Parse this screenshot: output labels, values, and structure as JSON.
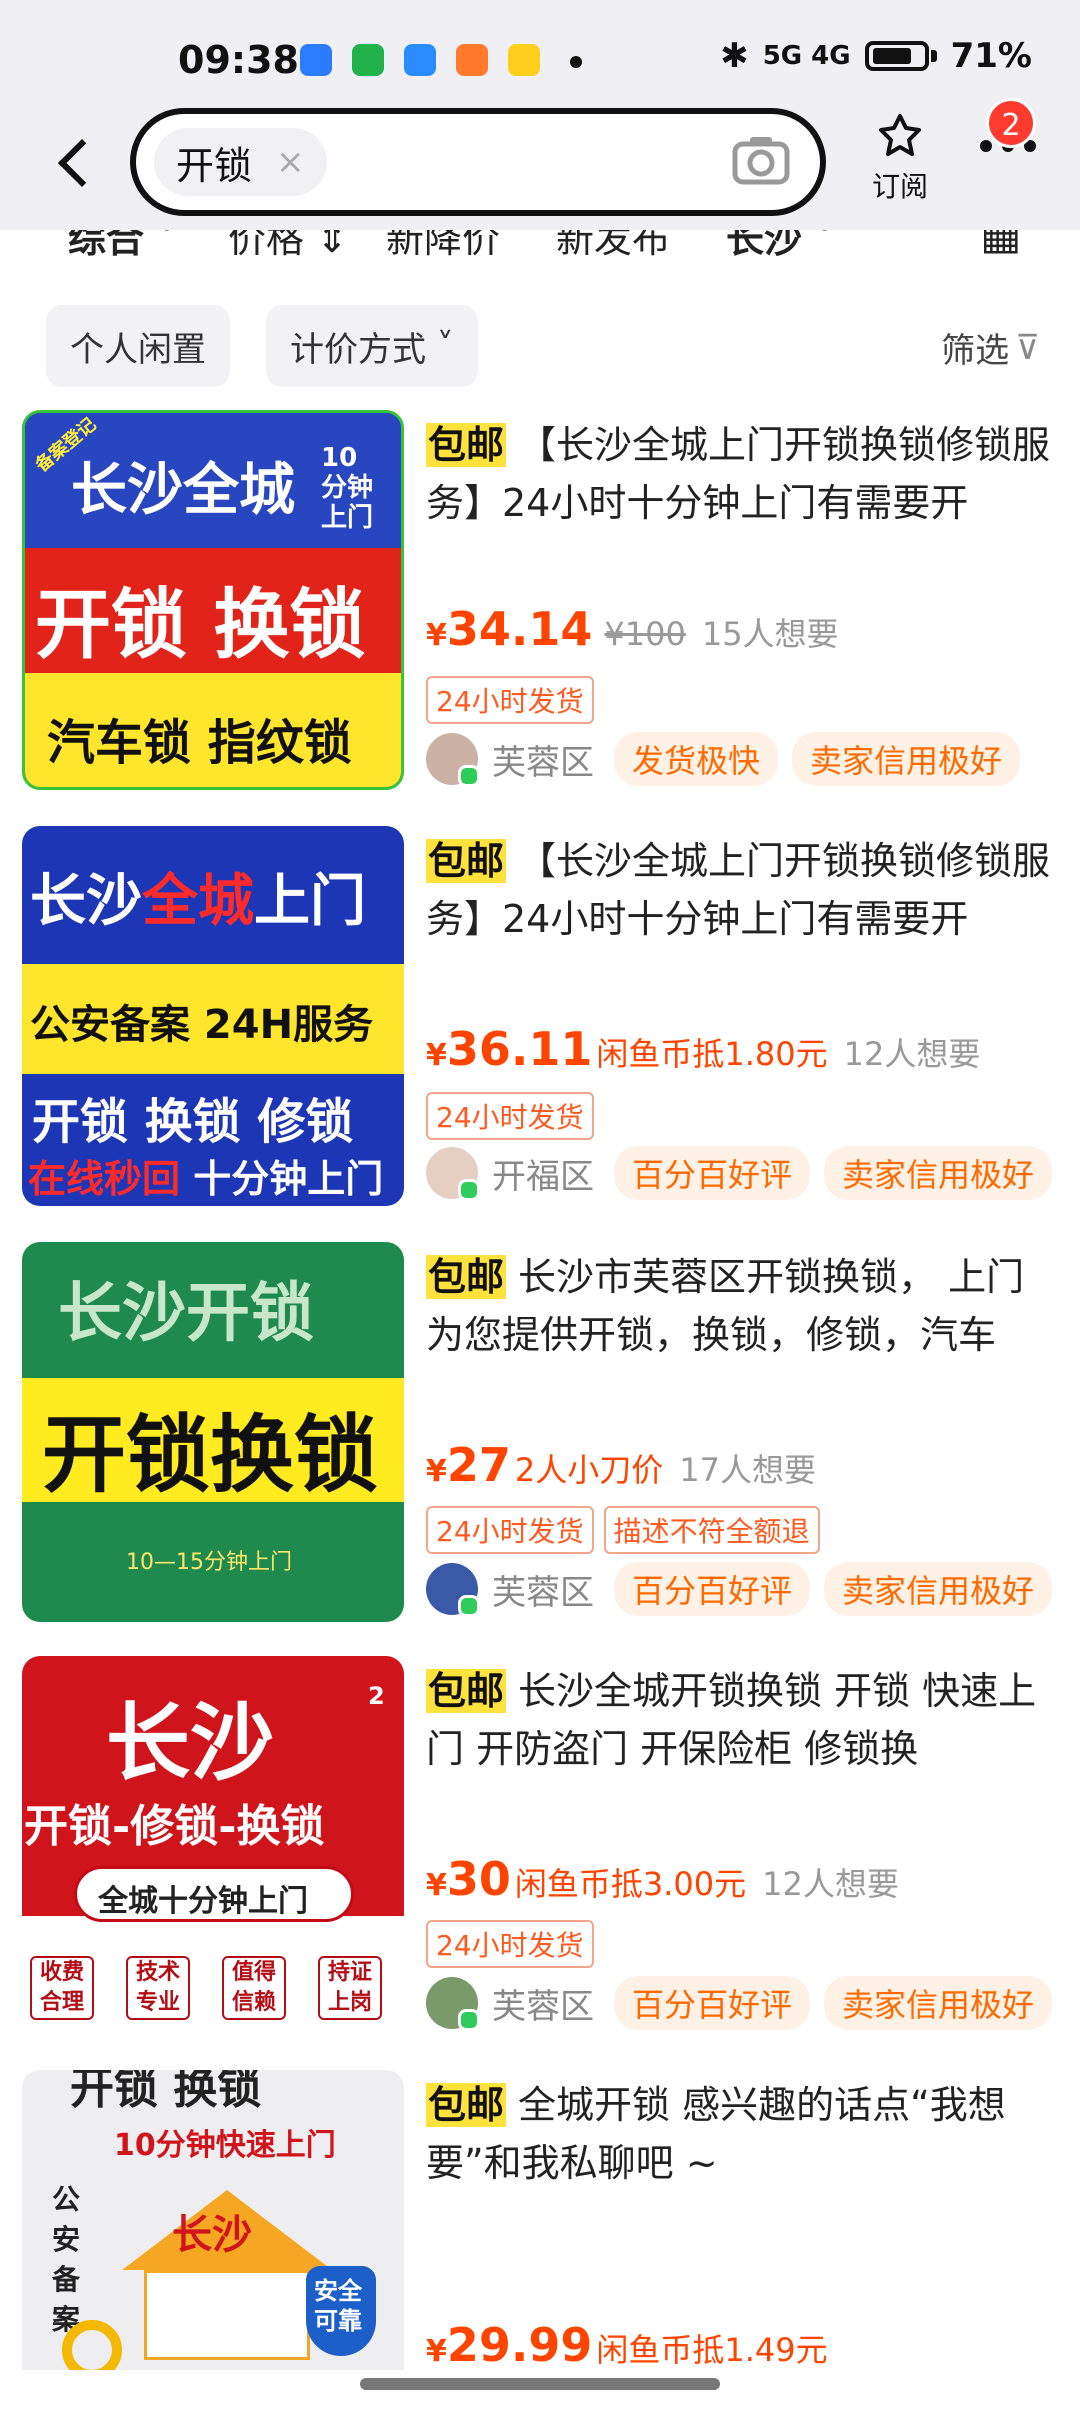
{
  "status_bar": {
    "time": "09:38",
    "network": "5G 4G",
    "battery": "71%"
  },
  "search": {
    "query": "开锁",
    "clear_symbol": "×"
  },
  "header": {
    "subscribe_label": "订阅",
    "notification_count": "2"
  },
  "sort_tabs": [
    "综合",
    "价格",
    "新降价",
    "新发布",
    "长沙"
  ],
  "filters": {
    "chips": [
      "个人闲置",
      "计价方式"
    ],
    "filter_label": "筛选"
  },
  "colors": {
    "price": "#ff4400",
    "tag_border": "#f3a58a",
    "baoyou_bg": "#ffe23b",
    "feature_bg": "#fff1e6"
  },
  "items": [
    {
      "thumb": {
        "line1": "长沙全城",
        "line1b": "10分钟上门",
        "line2": "开锁 换锁",
        "line3": "汽车锁 指纹锁",
        "stamp": "备案登记"
      },
      "baoyou": "包邮",
      "title": "【长沙全城上门开锁换锁修锁服务】24小时十分钟上门有需要开",
      "price": "34.14",
      "price_extra": "",
      "original_price": "¥100",
      "wants": "15人想要",
      "tags": [
        "24小时发货"
      ],
      "district": "芙蓉区",
      "features": [
        "发货极快",
        "卖家信用极好"
      ]
    },
    {
      "thumb": {
        "line1a": "长沙",
        "line1b": "全城",
        "line1c": "上门",
        "line2": "公安备案 24H服务",
        "line3": "开锁 换锁 修锁",
        "line4a": "在线秒回",
        "line4b": "十分钟上门"
      },
      "baoyou": "包邮",
      "title": "【长沙全城上门开锁换锁修锁服务】24小时十分钟上门有需要开",
      "price": "36.11",
      "price_extra": "闲鱼币抵1.80元",
      "original_price": "",
      "wants": "12人想要",
      "tags": [
        "24小时发货"
      ],
      "district": "开福区",
      "features": [
        "百分百好评",
        "卖家信用极好"
      ]
    },
    {
      "thumb": {
        "line1": "长沙开锁",
        "line2": "开锁换锁",
        "line3": "10—15分钟上门"
      },
      "baoyou": "包邮",
      "title": "长沙市芙蓉区开锁换锁， 上门为您提供开锁，换锁，修锁，汽车",
      "price": "27",
      "price_extra": "2人小刀价",
      "original_price": "",
      "wants": "17人想要",
      "tags": [
        "24小时发货",
        "描述不符全额退"
      ],
      "district": "芙蓉区",
      "features": [
        "百分百好评",
        "卖家信用极好"
      ]
    },
    {
      "thumb": {
        "corner": "2",
        "line1": "长沙",
        "line2": "开锁-修锁-换锁",
        "line3": "全城十分钟上门",
        "badges": [
          "收费合理",
          "技术专业",
          "值得信赖",
          "持证上岗"
        ]
      },
      "baoyou": "包邮",
      "title": "长沙全城开锁换锁 开锁 快速上门 开防盗门 开保险柜 修锁换",
      "price": "30",
      "price_extra": "闲鱼币抵3.00元",
      "original_price": "",
      "wants": "12人想要",
      "tags": [
        "24小时发货"
      ],
      "district": "芙蓉区",
      "features": [
        "百分百好评",
        "卖家信用极好"
      ]
    },
    {
      "thumb": {
        "line0": "开锁 换锁",
        "line1": "10分钟快速上门",
        "side": "公安备案",
        "center": "长沙",
        "shield": "安全可靠"
      },
      "baoyou": "包邮",
      "title": "全城开锁 感兴趣的话点“我想要”和我私聊吧 ~",
      "price": "29.99",
      "price_extra": "闲鱼币抵1.49元",
      "original_price": "",
      "wants": "",
      "tags": [],
      "district": "",
      "features": []
    }
  ]
}
